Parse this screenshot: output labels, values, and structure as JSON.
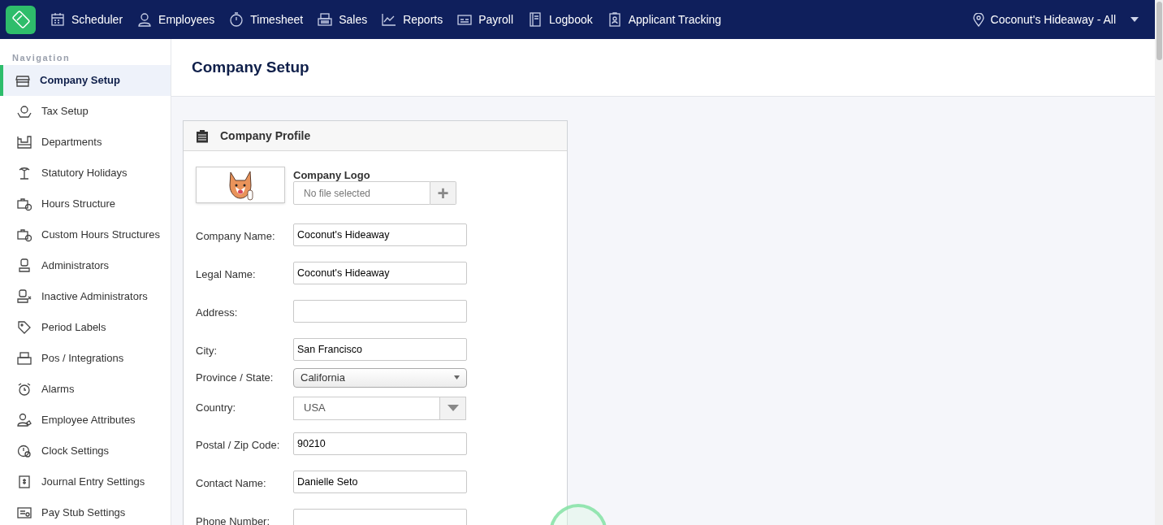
{
  "top_nav": {
    "items": [
      {
        "label": "Scheduler",
        "selected": false
      },
      {
        "label": "Employees",
        "selected": false
      },
      {
        "label": "Timesheet",
        "selected": false
      },
      {
        "label": "Sales",
        "selected": false
      },
      {
        "label": "Reports",
        "selected": false
      },
      {
        "label": "Payroll",
        "selected": false
      },
      {
        "label": "Logbook",
        "selected": false
      },
      {
        "label": "Applicant Tracking",
        "selected": false
      }
    ],
    "location": "Coconut's Hideaway - All"
  },
  "sidebar": {
    "heading": "Navigation",
    "items": [
      {
        "label": "Company Setup",
        "selected": true
      },
      {
        "label": "Tax Setup",
        "selected": false
      },
      {
        "label": "Departments",
        "selected": false
      },
      {
        "label": "Statutory Holidays",
        "selected": false
      },
      {
        "label": "Hours Structure",
        "selected": false
      },
      {
        "label": "Custom Hours Structures",
        "selected": false
      },
      {
        "label": "Administrators",
        "selected": false
      },
      {
        "label": "Inactive Administrators",
        "selected": false
      },
      {
        "label": "Period Labels",
        "selected": false
      },
      {
        "label": "Pos / Integrations",
        "selected": false
      },
      {
        "label": "Alarms",
        "selected": false
      },
      {
        "label": "Employee Attributes",
        "selected": false
      },
      {
        "label": "Clock Settings",
        "selected": false
      },
      {
        "label": "Journal Entry Settings",
        "selected": false
      },
      {
        "label": "Pay Stub Settings",
        "selected": false
      }
    ]
  },
  "page": {
    "title": "Company Setup"
  },
  "card": {
    "title": "Company Profile",
    "logo": {
      "label": "Company Logo",
      "placeholder": "No file selected",
      "button": "+"
    },
    "fields": [
      {
        "kind": "text",
        "label": "Company Name:",
        "value": "Coconut's Hideaway"
      },
      {
        "kind": "text",
        "label": "Legal Name:",
        "value": "Coconut's Hideaway"
      },
      {
        "kind": "text",
        "label": "Address:"
      },
      {
        "kind": "text",
        "label": "City:",
        "value": "San Francisco"
      },
      {
        "kind": "select",
        "label": "Province / State:",
        "value": "California"
      },
      {
        "kind": "combo",
        "label": "Country:",
        "value": "USA"
      },
      {
        "kind": "text",
        "label": "Postal / Zip Code:",
        "value": "90210"
      },
      {
        "kind": "text",
        "label": "Contact Name:",
        "value": "Danielle Seto"
      },
      {
        "kind": "text",
        "label": "Phone Number:"
      }
    ]
  }
}
